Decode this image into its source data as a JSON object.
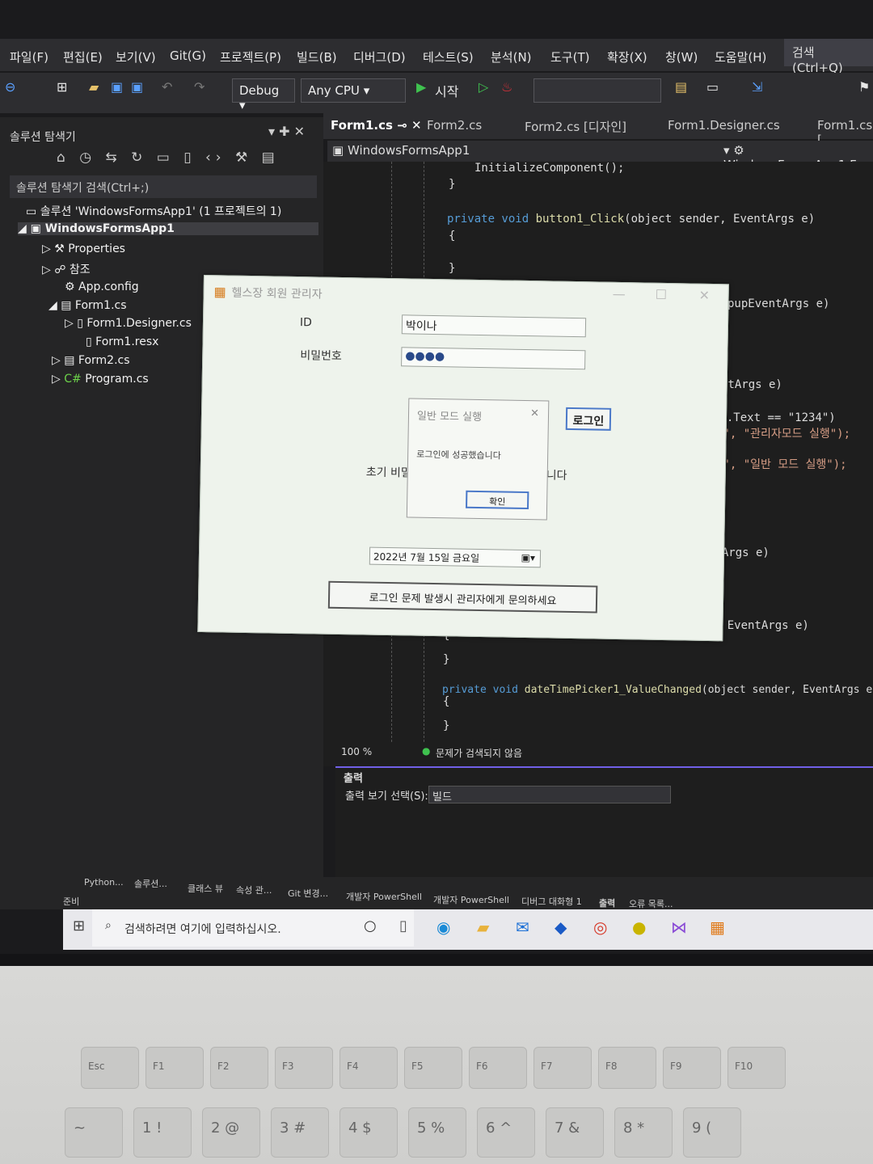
{
  "menu": [
    "파일(F)",
    "편집(E)",
    "보기(V)",
    "Git(G)",
    "프로젝트(P)",
    "빌드(B)",
    "디버그(D)",
    "테스트(S)",
    "분석(N)",
    "도구(T)",
    "확장(X)",
    "창(W)",
    "도움말(H)"
  ],
  "search": {
    "label": "검색 (Ctrl+Q)"
  },
  "toolbar": {
    "config": "Debug",
    "platform": "Any CPU",
    "start": "시작"
  },
  "solution_explorer": {
    "title": "솔루션 탐색기",
    "search_placeholder": "솔루션 탐색기 검색(Ctrl+;)",
    "items": [
      {
        "label": "솔루션 'WindowsFormsApp1' (1 프로젝트의 1)"
      },
      {
        "label": "WindowsFormsApp1"
      },
      {
        "label": "Properties"
      },
      {
        "label": "참조"
      },
      {
        "label": "App.config"
      },
      {
        "label": "Form1.cs"
      },
      {
        "label": "Form1.Designer.cs"
      },
      {
        "label": "Form1.resx"
      },
      {
        "label": "Form2.cs"
      },
      {
        "label": "Program.cs"
      }
    ]
  },
  "editor": {
    "tabs": [
      "Form1.cs",
      "Form2.cs",
      "Form2.cs [디자인]",
      "Form1.Designer.cs",
      "Form1.cs ["
    ],
    "nav_left": "WindowsFormsApp1",
    "nav_right": "WindowsFormsApp1.F",
    "code": {
      "l1": "InitializeComponent();",
      "l2": "}",
      "l3_kw": "private void ",
      "l3_fn": "button1_Click",
      "l3_rest": "(object sender, EventArgs e)",
      "l4": "{",
      "l5": "}",
      "r1": "pupEventArgs e)",
      "r2": "ntArgs e)",
      "r3": "호.Text == \"1234\")",
      "r4": "+\", \"관리자모드 실행\");",
      "r5": "+\", \"일반 모드 실행\");",
      "r6": "ntArgs e)",
      "r7": "er, EventArgs e)",
      "l6": "{",
      "l7": "}",
      "l8_kw": "private void ",
      "l8_fn": "dateTimePicker1_ValueChanged",
      "l8_rest": "(object sender, EventArgs e)",
      "l9": "{",
      "l10": "}"
    },
    "zoom": "100 %",
    "issues": "문제가 검색되지 않음"
  },
  "output": {
    "title": "출력",
    "select_label": "출력 보기 선택(S):",
    "select_value": "빌드"
  },
  "bottom_tabs": [
    "Python...",
    "솔루션...",
    "클래스 뷰",
    "속성 관...",
    "Git 변경...",
    "개발자 PowerShell",
    "개발자 PowerShell",
    "디버그 대화형 1",
    "출력",
    "오류 목록..."
  ],
  "status": "준비",
  "taskbar": {
    "search_placeholder": "검색하려면 여기에 입력하십시오."
  },
  "form": {
    "title": "헬스장 회원 관리자",
    "id_label": "ID",
    "id_value": "박이나",
    "pw_label": "비밀번호",
    "pw_value": "●●●●",
    "login_button": "로그인",
    "partial_left": "초기 비밀",
    "partial_right": "니다",
    "date_value": "2022년   7월 15일 금요일",
    "help_button": "로그인 문제 발생시 관리자에게 문의하세요"
  },
  "messagebox": {
    "title": "일반 모드 실행",
    "message": "로그인에 성공했습니다",
    "ok": "확인"
  },
  "keyboard": {
    "fn_keys": [
      "Esc",
      "F1",
      "F2",
      "F3",
      "F4",
      "F5",
      "F6",
      "F7",
      "F8",
      "F9",
      "F10"
    ],
    "num_keys": [
      "~",
      "1 !",
      "2 @",
      "3 #",
      "4 $",
      "5 %",
      "6 ^",
      "7 &",
      "8 *",
      "9 ("
    ]
  },
  "colors": {
    "accent": "#7160e8",
    "keyword": "#569cd6",
    "type": "#4ec9b0",
    "string": "#d69d85",
    "function": "#dcdcaa"
  }
}
